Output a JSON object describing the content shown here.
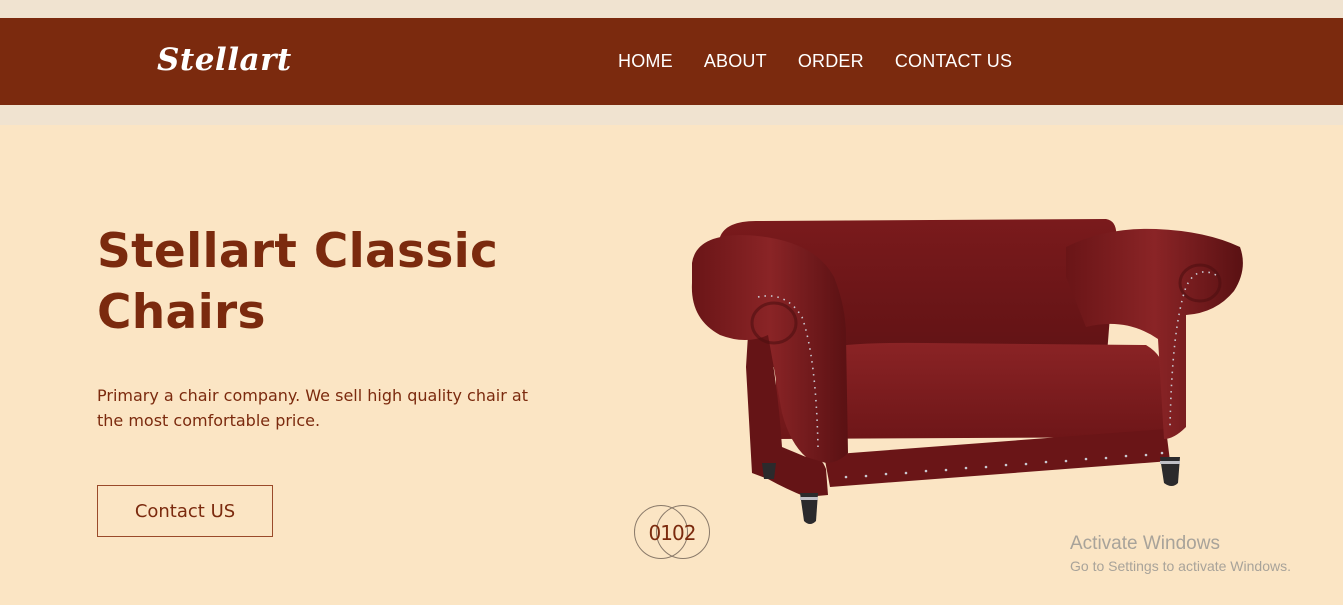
{
  "brand": {
    "logo_text": "Stellart"
  },
  "nav": {
    "items": [
      {
        "label": "HOME"
      },
      {
        "label": "ABOUT"
      },
      {
        "label": "ORDER"
      },
      {
        "label": "CONTACT US"
      }
    ]
  },
  "hero": {
    "title": "Stellart Classic Chairs",
    "description": "Primary a chair company. We sell high quality chair at the most comfortable price.",
    "cta_label": "Contact US",
    "product_image": "red-leather-tufted-sofa",
    "slider": {
      "numbers": "0102"
    }
  },
  "watermark": {
    "title": "Activate Windows",
    "subtitle": "Go to Settings to activate Windows."
  },
  "colors": {
    "navbar": "#7b2a0e",
    "hero_background": "#fbe5c4",
    "page_background": "#f0e3d0",
    "accent_text": "#7b2a0e",
    "sofa": "#7e1a1c"
  }
}
